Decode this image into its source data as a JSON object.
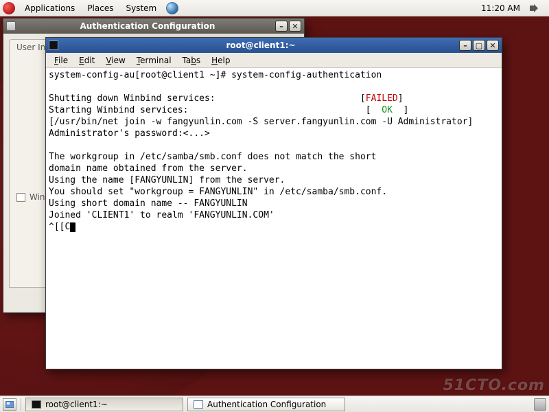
{
  "panel": {
    "menus": {
      "applications": "Applications",
      "places": "Places",
      "system": "System"
    },
    "clock": "11:20 AM"
  },
  "authWindow": {
    "title": "Authentication Configuration",
    "tab": "User Information",
    "winbind_label": "Winbind"
  },
  "terminal": {
    "title": "root@client1:~",
    "menus": {
      "file": "File",
      "edit": "Edit",
      "view": "View",
      "terminal": "Terminal",
      "tabs": "Tabs",
      "help": "Help"
    },
    "lines": {
      "l1": "system-config-au[root@client1 ~]# system-config-authentication",
      "l2": "",
      "l3a": "Shutting down Winbind services:                           [",
      "l3b": "FAILED",
      "l3c": "]",
      "l4a": "Starting Winbind services:                                 [  ",
      "l4b": "OK",
      "l4c": "  ]",
      "l5": "[/usr/bin/net join -w fangyunlin.com -S server.fangyunlin.com -U Administrator]",
      "l6": "Administrator's password:<...>",
      "l7": "",
      "l8": "The workgroup in /etc/samba/smb.conf does not match the short",
      "l9": "domain name obtained from the server.",
      "l10": "Using the name [FANGYUNLIN] from the server.",
      "l11": "You should set \"workgroup = FANGYUNLIN\" in /etc/samba/smb.conf.",
      "l12": "Using short domain name -- FANGYUNLIN",
      "l13": "Joined 'CLIENT1' to realm 'FANGYUNLIN.COM'",
      "l14": "^[[C"
    }
  },
  "taskbar": {
    "task1": "root@client1:~",
    "task2": "Authentication Configuration"
  },
  "watermark": "51CTO.com"
}
